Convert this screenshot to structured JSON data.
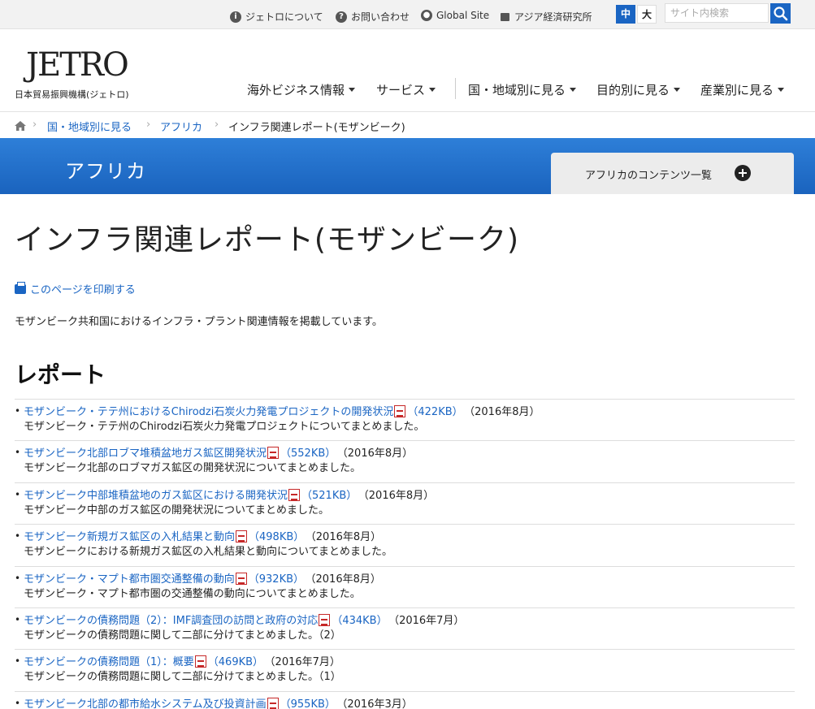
{
  "utility": {
    "links": [
      {
        "label": "ジェトロについて",
        "icon": "info-icon"
      },
      {
        "label": "お問い合わせ",
        "icon": "question-icon"
      },
      {
        "label": "Global Site",
        "icon": "globe-icon"
      },
      {
        "label": "アジア経済研究所",
        "icon": "building-icon"
      }
    ],
    "font_size_mid": "中",
    "font_size_large": "大",
    "search_placeholder": "サイト内検索"
  },
  "header": {
    "logo": "JETRO",
    "logo_sub": "日本貿易振興機構(ジェトロ)",
    "nav": [
      "海外ビジネス情報",
      "サービス",
      "国・地域別に見る",
      "目的別に見る",
      "産業別に見る"
    ]
  },
  "breadcrumb": {
    "items": [
      "国・地域別に見る",
      "アフリカ",
      "インフラ関連レポート(モザンビーク)"
    ]
  },
  "region": {
    "title": "アフリカ",
    "contents_label": "アフリカのコンテンツ一覧"
  },
  "main": {
    "title": "インフラ関連レポート(モザンビーク)",
    "print_label": "このページを印刷する",
    "intro": "モザンビーク共和国におけるインフラ・プラント関連情報を掲載しています。",
    "section_heading": "レポート",
    "reports": [
      {
        "title": "モザンビーク・テテ州におけるChirodzi石炭火力発電プロジェクトの開発状況",
        "size": "（422KB）",
        "date": "（2016年8月）",
        "desc": "モザンビーク・テテ州のChirodzi石炭火力発電プロジェクトについてまとめました。"
      },
      {
        "title": "モザンビーク北部ロブマ堆積盆地ガス鉱区開発状況",
        "size": "（552KB）",
        "date": "（2016年8月）",
        "desc": "モザンビーク北部のロブマガス鉱区の開発状況についてまとめました。"
      },
      {
        "title": "モザンビーク中部堆積盆地のガス鉱区における開発状況",
        "size": "（521KB）",
        "date": "（2016年8月）",
        "desc": "モザンビーク中部のガス鉱区の開発状況についてまとめました。"
      },
      {
        "title": "モザンビーク新規ガス鉱区の入札結果と動向",
        "size": "（498KB）",
        "date": "（2016年8月）",
        "desc": "モザンビークにおける新規ガス鉱区の入札結果と動向についてまとめました。"
      },
      {
        "title": "モザンビーク・マプト都市圏交通整備の動向",
        "size": "（932KB）",
        "date": "（2016年8月）",
        "desc": "モザンビーク・マプト都市圏の交通整備の動向についてまとめました。"
      },
      {
        "title": "モザンビークの債務問題（2）：IMF調査団の訪問と政府の対応",
        "size": "（434KB）",
        "date": "（2016年7月）",
        "desc": "モザンビークの債務問題に関して二部に分けてまとめました。（2）"
      },
      {
        "title": "モザンビークの債務問題（1）：概要",
        "size": "（469KB）",
        "date": "（2016年7月）",
        "desc": "モザンビークの債務問題に関して二部に分けてまとめました。（1）"
      },
      {
        "title": "モザンビーク北部の都市給水システム及び投資計画",
        "size": "（955KB）",
        "date": "（2016年3月）",
        "desc": ""
      }
    ]
  }
}
